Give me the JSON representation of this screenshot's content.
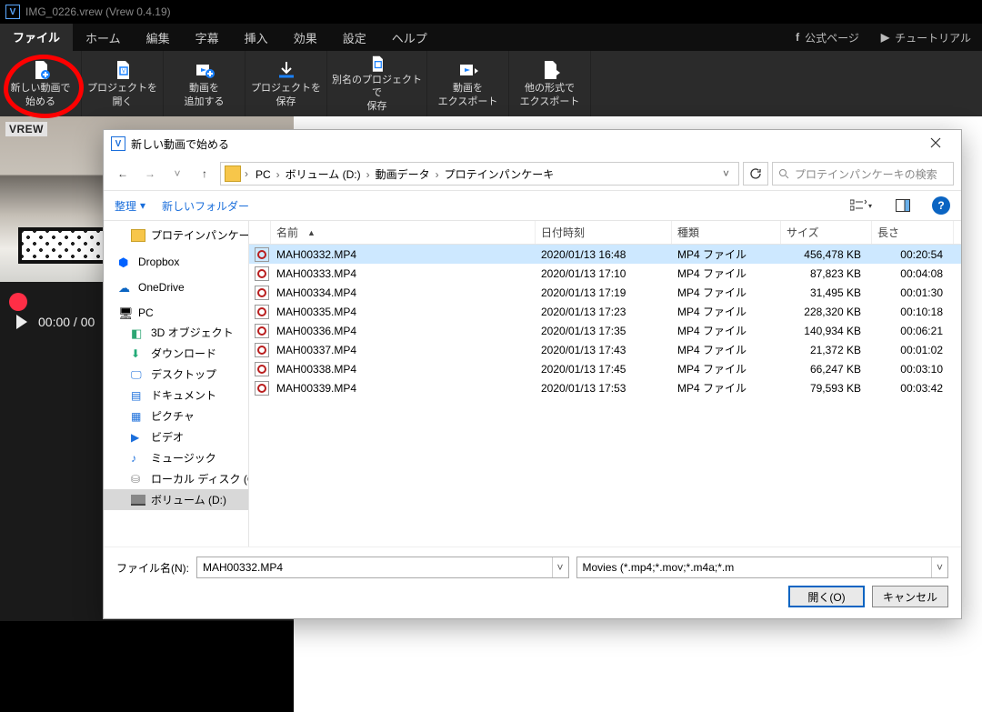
{
  "app": {
    "title": "IMG_0226.vrew (Vrew 0.4.19)"
  },
  "menu": {
    "items": [
      "ファイル",
      "ホーム",
      "編集",
      "字幕",
      "挿入",
      "効果",
      "設定",
      "ヘルプ"
    ],
    "active_index": 0,
    "official_page": "公式ページ",
    "tutorial": "チュートリアル"
  },
  "ribbon": {
    "items": [
      {
        "l1": "新しい動画で",
        "l2": "始める"
      },
      {
        "l1": "プロジェクトを",
        "l2": "開く"
      },
      {
        "l1": "動画を",
        "l2": "追加する"
      },
      {
        "l1": "プロジェクトを",
        "l2": "保存"
      },
      {
        "l1": "別名のプロジェクトで",
        "l2": "保存"
      },
      {
        "l1": "動画を",
        "l2": "エクスポート"
      },
      {
        "l1": "他の形式で",
        "l2": "エクスポート"
      }
    ]
  },
  "preview": {
    "badge": "VREW",
    "time": "00:00 / 00"
  },
  "dialog": {
    "title": "新しい動画で始める",
    "crumbs": [
      "PC",
      "ボリューム (D:)",
      "動画データ",
      "プロテインパンケーキ"
    ],
    "search_placeholder": "プロテインパンケーキの検索",
    "toolbar": {
      "organize": "整理",
      "new_folder": "新しいフォルダー"
    },
    "tree": [
      {
        "label": "プロテインパンケー",
        "icon": "folder",
        "level": 2
      },
      {
        "label": "Dropbox",
        "icon": "dropbox",
        "level": 1,
        "gap": true
      },
      {
        "label": "OneDrive",
        "icon": "onedrive",
        "level": 1,
        "gap": true
      },
      {
        "label": "PC",
        "icon": "pc",
        "level": 1,
        "gap": true
      },
      {
        "label": "3D オブジェクト",
        "icon": "cube",
        "level": 2
      },
      {
        "label": "ダウンロード",
        "icon": "dl",
        "level": 2
      },
      {
        "label": "デスクトップ",
        "icon": "desk",
        "level": 2
      },
      {
        "label": "ドキュメント",
        "icon": "doc",
        "level": 2
      },
      {
        "label": "ピクチャ",
        "icon": "pic",
        "level": 2
      },
      {
        "label": "ビデオ",
        "icon": "vid",
        "level": 2
      },
      {
        "label": "ミュージック",
        "icon": "mus",
        "level": 2
      },
      {
        "label": "ローカル ディスク (C",
        "icon": "disk",
        "level": 2
      },
      {
        "label": "ボリューム (D:)",
        "icon": "vol",
        "level": 2,
        "selected": true
      }
    ],
    "columns": {
      "name": "名前",
      "date": "日付時刻",
      "type": "種類",
      "size": "サイズ",
      "len": "長さ"
    },
    "files": [
      {
        "name": "MAH00332.MP4",
        "date": "2020/01/13 16:48",
        "type": "MP4 ファイル",
        "size": "456,478 KB",
        "len": "00:20:54",
        "selected": true
      },
      {
        "name": "MAH00333.MP4",
        "date": "2020/01/13 17:10",
        "type": "MP4 ファイル",
        "size": "87,823 KB",
        "len": "00:04:08"
      },
      {
        "name": "MAH00334.MP4",
        "date": "2020/01/13 17:19",
        "type": "MP4 ファイル",
        "size": "31,495 KB",
        "len": "00:01:30"
      },
      {
        "name": "MAH00335.MP4",
        "date": "2020/01/13 17:23",
        "type": "MP4 ファイル",
        "size": "228,320 KB",
        "len": "00:10:18"
      },
      {
        "name": "MAH00336.MP4",
        "date": "2020/01/13 17:35",
        "type": "MP4 ファイル",
        "size": "140,934 KB",
        "len": "00:06:21"
      },
      {
        "name": "MAH00337.MP4",
        "date": "2020/01/13 17:43",
        "type": "MP4 ファイル",
        "size": "21,372 KB",
        "len": "00:01:02"
      },
      {
        "name": "MAH00338.MP4",
        "date": "2020/01/13 17:45",
        "type": "MP4 ファイル",
        "size": "66,247 KB",
        "len": "00:03:10"
      },
      {
        "name": "MAH00339.MP4",
        "date": "2020/01/13 17:53",
        "type": "MP4 ファイル",
        "size": "79,593 KB",
        "len": "00:03:42"
      }
    ],
    "footer": {
      "filename_label": "ファイル名(N):",
      "filename_value": "MAH00332.MP4",
      "filter": "Movies (*.mp4;*.mov;*.m4a;*.m",
      "open_btn": "開く(O)",
      "cancel_btn": "キャンセル"
    }
  }
}
